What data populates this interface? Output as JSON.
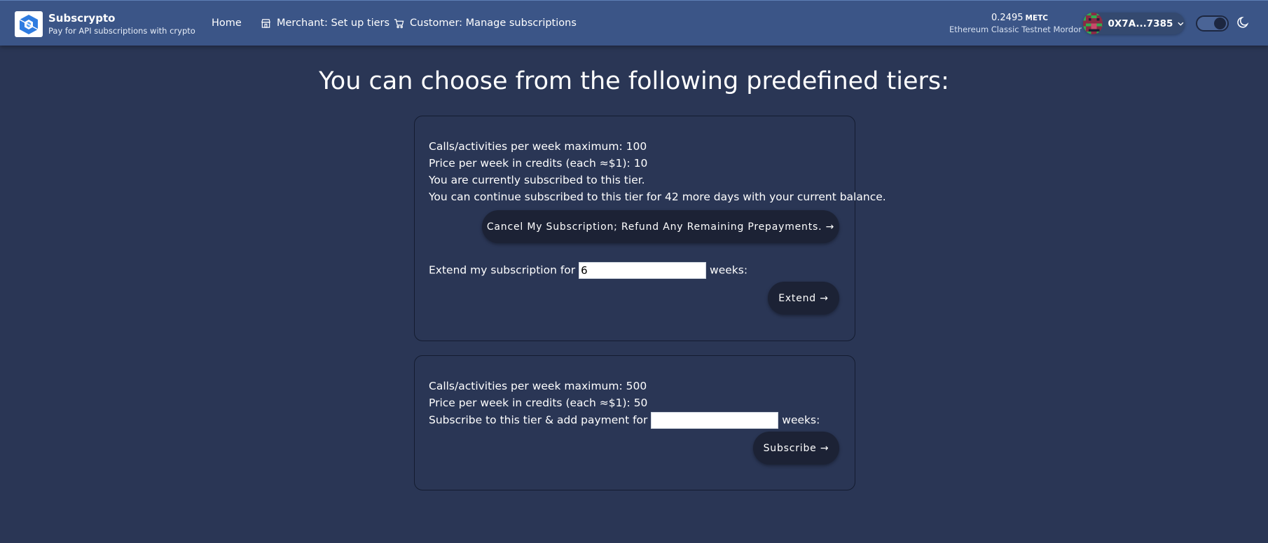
{
  "header": {
    "brand_name": "Subscrypto",
    "brand_tagline": "Pay for API subscriptions with crypto",
    "nav": [
      {
        "label": "Home",
        "icon": ""
      },
      {
        "label": "Merchant: Set up tiers",
        "icon": "storefront-icon"
      },
      {
        "label": "Customer: Manage subscriptions",
        "icon": "cart-icon"
      }
    ],
    "balance_amount": "0.2495",
    "balance_unit": "METC",
    "network_name": "Ethereum Classic Testnet Mordor",
    "wallet_address": "0X7A...7385",
    "theme_toggle": "dark"
  },
  "main": {
    "title": "You can choose from the following predefined tiers:",
    "tiers": [
      {
        "calls_line": "Calls/activities per week maximum: 100",
        "price_line": "Price per week in credits (each ≈$1): 10",
        "status_line": "You are currently subscribed to this tier.",
        "balance_line": "You can continue subscribed to this tier for 42 more days with your current balance.",
        "cancel_label": "Cancel My Subscription; Refund Any Remaining Prepayments. →",
        "extend_prefix": "Extend my subscription for",
        "extend_value": "6",
        "extend_suffix": "weeks:",
        "extend_label": "Extend →"
      },
      {
        "calls_line": "Calls/activities per week maximum: 500",
        "price_line": "Price per week in credits (each ≈$1): 50",
        "subscribe_prefix": "Subscribe to this tier & add payment for",
        "subscribe_value": "",
        "subscribe_suffix": "weeks:",
        "subscribe_label": "Subscribe →"
      }
    ]
  },
  "colors": {
    "background": "#2a3655",
    "header": "#3b5587",
    "button": "#1c2235",
    "logo_blue": "#2f7ce0"
  }
}
